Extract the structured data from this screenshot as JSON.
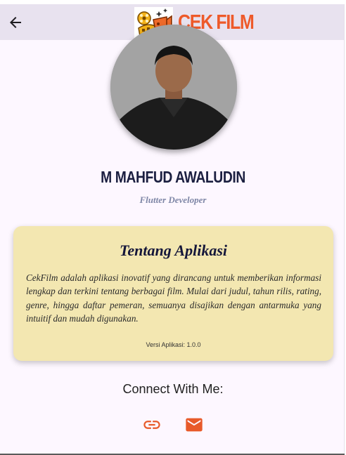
{
  "appbar": {
    "brand": "CEK FILM",
    "back_icon": "arrow-left-icon",
    "logo_icon": "film-logo-icon"
  },
  "profile": {
    "name": "M MAHFUD AWALUDIN",
    "role": "Flutter Developer"
  },
  "about": {
    "title": "Tentang Aplikasi",
    "description": "CekFilm adalah aplikasi inovatif yang dirancang untuk memberikan informasi lengkap dan terkini tentang berbagai film. Mulai dari judul, tahun rilis, rating, genre, hingga daftar pemeran, semuanya disajikan dengan antarmuka yang intuitif dan mudah digunakan.",
    "version": "Versi Aplikasi: 1.0.0"
  },
  "connect": {
    "label": "Connect With Me:",
    "link_icon": "link-icon",
    "mail_icon": "mail-icon"
  },
  "colors": {
    "brand": "#ee5a2a",
    "appbar": "#e8e2ef",
    "card": "#f3e7b1",
    "name": "#1b1f40",
    "role": "#7e86a6"
  }
}
